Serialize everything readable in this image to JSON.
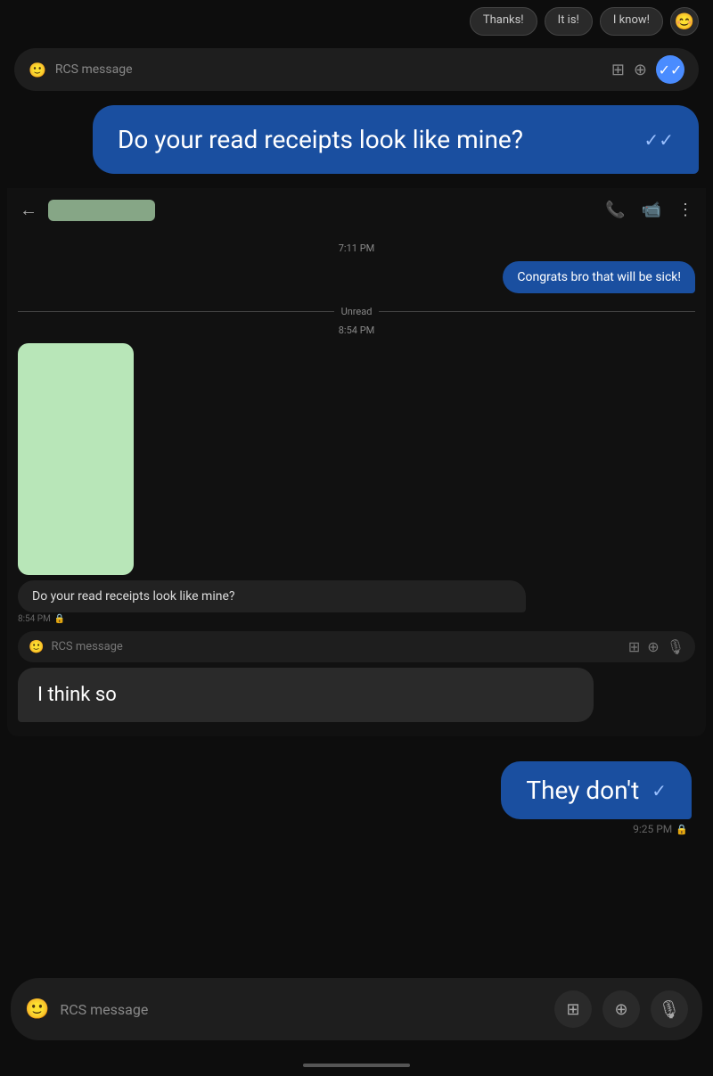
{
  "quick_replies": {
    "items": [
      "Thanks!",
      "It is!",
      "I know!"
    ],
    "emoji": "😊"
  },
  "top_input": {
    "placeholder": "RCS message"
  },
  "big_sent_bubble": {
    "text": "Do your read receipts look like mine?",
    "checkmark": "✓✓"
  },
  "phone": {
    "header": {
      "contact_name_placeholder": "",
      "icons": [
        "📞",
        "📹",
        "⋮"
      ]
    },
    "messages": [
      {
        "time": "7:11 PM",
        "type": "sent",
        "text": "Congrats bro that will be sick!"
      }
    ],
    "unread_label": "Unread",
    "time2": "8:54 PM",
    "sent_query": "Do your read receipts look like mine?",
    "sent_time": "8:54 PM",
    "input_placeholder": "RCS message"
  },
  "typing_bubble": {
    "text": "I think so"
  },
  "they_dont": {
    "text": "They don't",
    "checkmark": "✓"
  },
  "time_right": "9:25 PM",
  "bottom_input": {
    "placeholder": "RCS message"
  },
  "colors": {
    "sent_bubble": "#1a4fa0",
    "received_bubble": "#2a2a2a",
    "bg": "#0d0d0d",
    "input_bg": "#1e1e1e",
    "green_image": "#b8e6b8"
  }
}
